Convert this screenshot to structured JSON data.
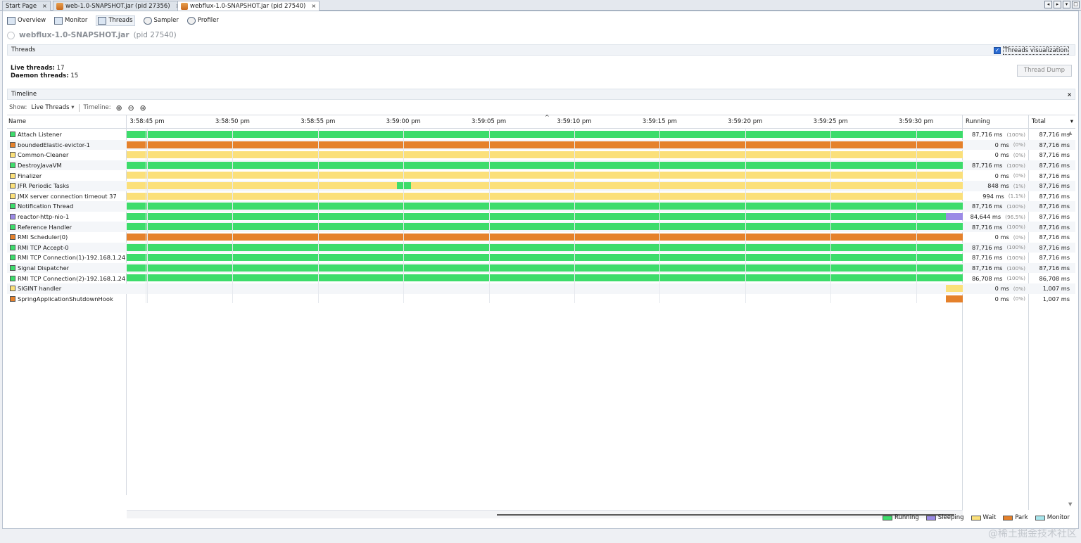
{
  "colors": {
    "running": "#3ddc6b",
    "sleeping": "#9b8ae6",
    "wait": "#fbe07a",
    "park": "#e5812b",
    "monitor": "#a7e6ec"
  },
  "tabs": [
    {
      "label": "Start Page",
      "close": "×",
      "active": false
    },
    {
      "label": "web-1.0-SNAPSHOT.jar (pid 27356)",
      "close": "×",
      "active": false
    },
    {
      "label": "webflux-1.0-SNAPSHOT.jar (pid 27540)",
      "close": "×",
      "active": true
    }
  ],
  "view_tabs": [
    "Overview",
    "Monitor",
    "Threads",
    "Sampler",
    "Profiler"
  ],
  "app": {
    "name": "webflux-1.0-SNAPSHOT.jar",
    "pid": "(pid 27540)"
  },
  "threads_section": {
    "title": "Threads",
    "visualization_label": "Threads visualization",
    "live_label": "Live threads:",
    "live_value": "17",
    "daemon_label": "Daemon threads:",
    "daemon_value": "15",
    "dump_button": "Thread Dump"
  },
  "timeline_section": {
    "title": "Timeline",
    "close": "×",
    "show_label": "Show:",
    "show_value": "Live Threads",
    "timeline_label": "Timeline:"
  },
  "columns": {
    "name": "Name",
    "running": "Running",
    "total": "Total"
  },
  "ticks": [
    "3:58:45 pm",
    "3:58:50 pm",
    "3:58:55 pm",
    "3:59:00 pm",
    "3:59:05 pm",
    "3:59:10 pm",
    "3:59:15 pm",
    "3:59:20 pm",
    "3:59:25 pm",
    "3:59:30 pm"
  ],
  "threads": [
    {
      "name": "Attach Listener",
      "state": "running",
      "running": "87,716 ms",
      "pct": "(100%)",
      "total": "87,716 ms",
      "segments": [
        [
          "running",
          0,
          1
        ]
      ]
    },
    {
      "name": "boundedElastic-evictor-1",
      "state": "park",
      "running": "0 ms",
      "pct": "(0%)",
      "total": "87,716 ms",
      "segments": [
        [
          "park",
          0,
          1
        ]
      ]
    },
    {
      "name": "Common-Cleaner",
      "state": "wait",
      "running": "0 ms",
      "pct": "(0%)",
      "total": "87,716 ms",
      "segments": [
        [
          "wait",
          0,
          1
        ]
      ]
    },
    {
      "name": "DestroyJavaVM",
      "state": "running",
      "running": "87,716 ms",
      "pct": "(100%)",
      "total": "87,716 ms",
      "segments": [
        [
          "running",
          0,
          1
        ]
      ]
    },
    {
      "name": "Finalizer",
      "state": "wait",
      "running": "0 ms",
      "pct": "(0%)",
      "total": "87,716 ms",
      "segments": [
        [
          "wait",
          0,
          1
        ]
      ]
    },
    {
      "name": "JFR Periodic Tasks",
      "state": "wait",
      "running": "848 ms",
      "pct": "(1%)",
      "total": "87,716 ms",
      "segments": [
        [
          "wait",
          0,
          0.323
        ],
        [
          "running",
          0.323,
          0.34
        ],
        [
          "wait",
          0.34,
          1
        ]
      ]
    },
    {
      "name": "JMX server connection timeout 37",
      "state": "wait",
      "running": "994 ms",
      "pct": "(1.1%)",
      "total": "87,716 ms",
      "segments": [
        [
          "wait",
          0,
          1
        ]
      ]
    },
    {
      "name": "Notification Thread",
      "state": "running",
      "running": "87,716 ms",
      "pct": "(100%)",
      "total": "87,716 ms",
      "segments": [
        [
          "running",
          0,
          1
        ]
      ]
    },
    {
      "name": "reactor-http-nio-1",
      "state": "sleeping",
      "running": "84,644 ms",
      "pct": "(96.5%)",
      "total": "87,716 ms",
      "segments": [
        [
          "running",
          0,
          0.98
        ],
        [
          "sleeping",
          0.98,
          1
        ]
      ]
    },
    {
      "name": "Reference Handler",
      "state": "running",
      "running": "87,716 ms",
      "pct": "(100%)",
      "total": "87,716 ms",
      "segments": [
        [
          "running",
          0,
          1
        ]
      ]
    },
    {
      "name": "RMI Scheduler(0)",
      "state": "park",
      "running": "0 ms",
      "pct": "(0%)",
      "total": "87,716 ms",
      "segments": [
        [
          "park",
          0,
          1
        ]
      ]
    },
    {
      "name": "RMI TCP Accept-0",
      "state": "running",
      "running": "87,716 ms",
      "pct": "(100%)",
      "total": "87,716 ms",
      "segments": [
        [
          "running",
          0,
          1
        ]
      ]
    },
    {
      "name": "RMI TCP Connection(1)-192.168.1.24",
      "state": "running",
      "running": "87,716 ms",
      "pct": "(100%)",
      "total": "87,716 ms",
      "segments": [
        [
          "running",
          0,
          1
        ]
      ]
    },
    {
      "name": "Signal Dispatcher",
      "state": "running",
      "running": "87,716 ms",
      "pct": "(100%)",
      "total": "87,716 ms",
      "segments": [
        [
          "running",
          0,
          1
        ]
      ]
    },
    {
      "name": "RMI TCP Connection(2)-192.168.1.24",
      "state": "running",
      "running": "86,708 ms",
      "pct": "(100%)",
      "total": "86,708 ms",
      "segments": [
        [
          "running",
          0,
          1
        ]
      ]
    },
    {
      "name": "SIGINT handler",
      "state": "wait",
      "running": "0 ms",
      "pct": "(0%)",
      "total": "1,007 ms",
      "segments": [
        [
          "wait",
          0.98,
          1
        ]
      ]
    },
    {
      "name": "SpringApplicationShutdownHook",
      "state": "park",
      "running": "0 ms",
      "pct": "(0%)",
      "total": "1,007 ms",
      "segments": [
        [
          "park",
          0.98,
          1
        ]
      ]
    }
  ],
  "legend": [
    {
      "label": "Running",
      "state": "running"
    },
    {
      "label": "Sleeping",
      "state": "sleeping"
    },
    {
      "label": "Wait",
      "state": "wait"
    },
    {
      "label": "Park",
      "state": "park"
    },
    {
      "label": "Monitor",
      "state": "monitor"
    }
  ],
  "watermark": "@稀土掘金技术社区"
}
